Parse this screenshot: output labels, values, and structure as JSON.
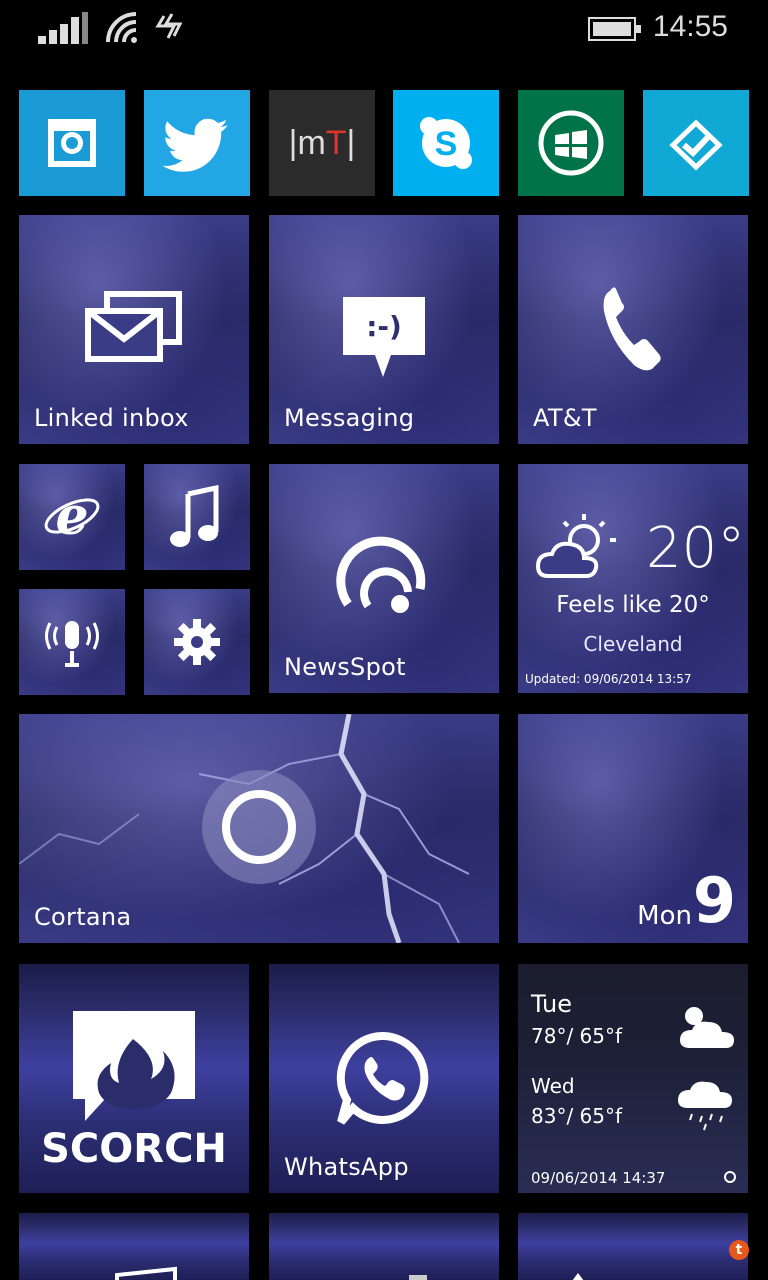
{
  "status_bar": {
    "time": "14:55"
  },
  "small_tiles": [
    {
      "name": "camera",
      "color": "#1b9bd6"
    },
    {
      "name": "twitter",
      "color": "#22a6e4"
    },
    {
      "name": "mt",
      "label": "|mT|",
      "color": "#2b2b2b"
    },
    {
      "name": "skype",
      "color": "#00aff0"
    },
    {
      "name": "store",
      "color": "#00734a"
    },
    {
      "name": "tasks",
      "color": "#10a9d6"
    }
  ],
  "tiles": {
    "linked_inbox": {
      "label": "Linked inbox"
    },
    "messaging": {
      "label": "Messaging",
      "icon_text": ":-)"
    },
    "att": {
      "label": "AT&T"
    },
    "newsspot": {
      "label": "NewsSpot"
    },
    "weather": {
      "temp": "20°",
      "feels_like": "Feels like 20°",
      "city": "Cleveland",
      "updated": "Updated: 09/06/2014 13:57"
    },
    "cortana": {
      "label": "Cortana"
    },
    "calendar": {
      "day": "Mon",
      "date": "9"
    },
    "scorch": {
      "label": "SCORCH"
    },
    "whatsapp": {
      "label": "WhatsApp"
    },
    "forecast": {
      "day1": "Tue",
      "day1_temp": "78°/ 65°f",
      "day2": "Wed",
      "day2_temp": "83°/ 65°f",
      "timestamp": "09/06/2014 14:37"
    }
  }
}
